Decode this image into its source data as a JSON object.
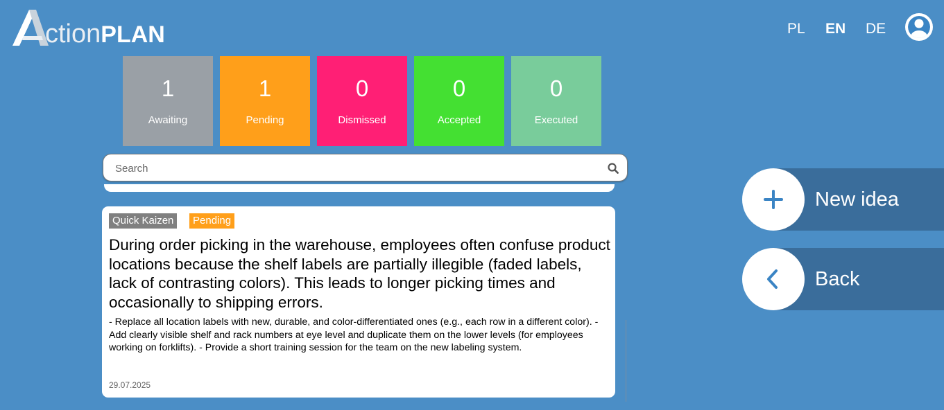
{
  "header": {
    "logo_part1": "ction",
    "logo_part2": "PLAN",
    "languages": [
      {
        "code": "PL",
        "active": false
      },
      {
        "code": "EN",
        "active": true
      },
      {
        "code": "DE",
        "active": false
      }
    ],
    "user_icon": "user-circle-icon"
  },
  "status_tiles": [
    {
      "count": "1",
      "label": "Awaiting",
      "color": "#9aa0a6"
    },
    {
      "count": "1",
      "label": "Pending",
      "color": "#ff9f1a"
    },
    {
      "count": "0",
      "label": "Dismissed",
      "color": "#ff1f75"
    },
    {
      "count": "0",
      "label": "Accepted",
      "color": "#44e032"
    },
    {
      "count": "0",
      "label": "Executed",
      "color": "#79cc9b"
    }
  ],
  "search": {
    "placeholder": "Search",
    "value": "",
    "icon": "search-icon"
  },
  "ideas": [
    {
      "category": "Quick Kaizen",
      "status": "Pending",
      "title": "During order picking in the warehouse, employees often confuse product locations because the shelf labels are partially illegible (faded labels, lack of contrasting colors). This leads to longer picking times and occasionally to shipping errors.",
      "description": "- Replace all location labels with new, durable, and color-differentiated ones (e.g., each row in a different color).  - Add clearly visible shelf and rack numbers at eye level and duplicate them on the lower levels (for employees working on forklifts).  - Provide a short training session for the team on the new labeling system.",
      "date": "29.07.2025"
    }
  ],
  "actions": {
    "new_idea_label": "New idea",
    "new_idea_icon": "plus-icon",
    "back_label": "Back",
    "back_icon": "chevron-left-icon"
  },
  "colors": {
    "background": "#4b8ec6",
    "action_bar": "#3a6d9b",
    "accent": "#3a84c4"
  }
}
